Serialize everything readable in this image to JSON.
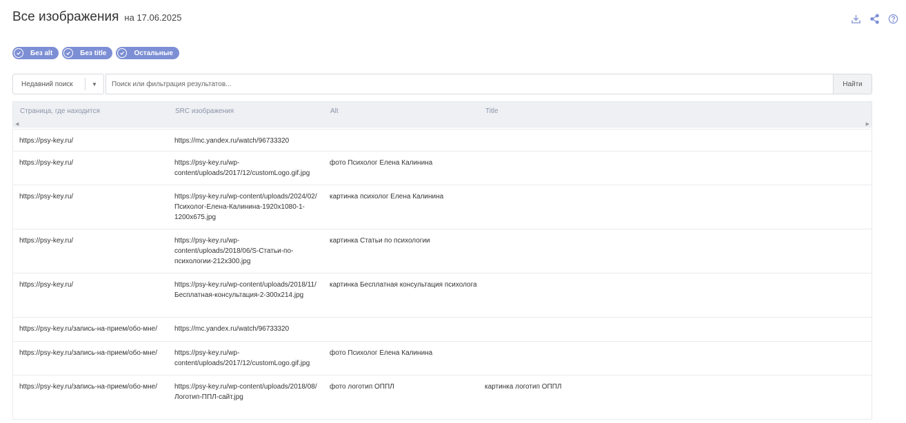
{
  "header": {
    "title": "Все изображения",
    "date": "на 17.06.2025"
  },
  "icons": {
    "download": "download-icon",
    "share": "share-icon",
    "help": "help-icon"
  },
  "colors": {
    "chip_bg": "#7d8fd4",
    "header_bg": "#eef0f3"
  },
  "filters": [
    {
      "label": "Без alt",
      "checked": true
    },
    {
      "label": "Без title",
      "checked": true
    },
    {
      "label": "Остальные",
      "checked": true
    }
  ],
  "search": {
    "recent_label": "Недавний поиск",
    "placeholder": "Поиск или фильтрация результатов...",
    "button_label": "Найти"
  },
  "table": {
    "columns": [
      "Страница, где находится",
      "SRC изображения",
      "Alt",
      "Title"
    ],
    "rows": [
      {
        "page": "https://psy-key.ru/",
        "src": "https://mc.yandex.ru/watch/96733320",
        "alt": "",
        "title": ""
      },
      {
        "page": "https://psy-key.ru/",
        "src": "https://psy-key.ru/wp-content/uploads/2017/12/customLogo.gif.jpg",
        "alt": "фото Психолог Елена Калинина",
        "title": ""
      },
      {
        "page": "https://psy-key.ru/",
        "src": "https://psy-key.ru/wp-content/uploads/2024/02/Психолог-Елена-Калинина-1920x1080-1-1200x675.jpg",
        "alt": "картинка психолог Елена Калинина",
        "title": ""
      },
      {
        "page": "https://psy-key.ru/",
        "src": "https://psy-key.ru/wp-content/uploads/2018/06/S-Статьи-по-психологии-212x300.jpg",
        "alt": "картинка Статьи по психологии",
        "title": ""
      },
      {
        "page": "https://psy-key.ru/",
        "src": "https://psy-key.ru/wp-content/uploads/2018/11/Бесплатная-консультация-2-300x214.jpg",
        "alt": "картинка Бесплатная консультация психолога",
        "title": ""
      },
      {
        "page": "https://psy-key.ru/запись-на-прием/обо-мне/",
        "src": "https://mc.yandex.ru/watch/96733320",
        "alt": "",
        "title": ""
      },
      {
        "page": "https://psy-key.ru/запись-на-прием/обо-мне/",
        "src": "https://psy-key.ru/wp-content/uploads/2017/12/customLogo.gif.jpg",
        "alt": "фото Психолог Елена Калинина",
        "title": ""
      },
      {
        "page": "https://psy-key.ru/запись-на-прием/обо-мне/",
        "src": "https://psy-key.ru/wp-content/uploads/2018/08/Логотип-ППЛ-сайт.jpg",
        "alt": "фото логотип ОППЛ",
        "title": "картинка логотип ОППЛ"
      }
    ]
  }
}
